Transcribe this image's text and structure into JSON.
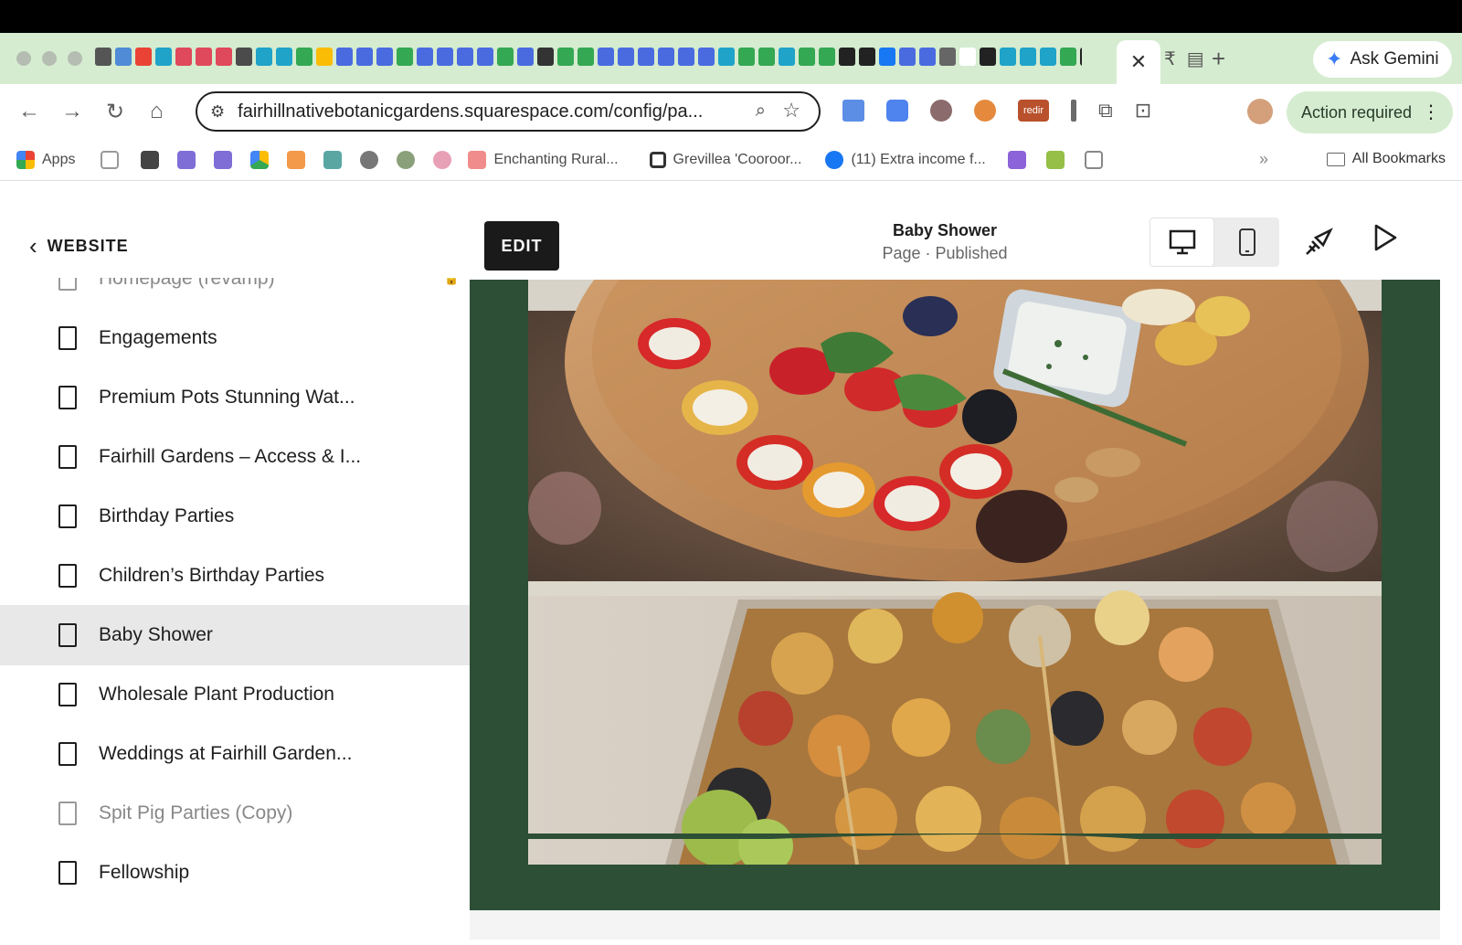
{
  "browser": {
    "ask_gemini_label": "Ask Gemini",
    "url": "fairhillnativebotanicgardens.squarespace.com/config/pa...",
    "action_required_label": "Action required",
    "bookmarks": {
      "apps_label": "Apps",
      "items": [
        "Enchanting Rural...",
        "Grevillea 'Cooroor...",
        "(11) Extra income f..."
      ],
      "all_bookmarks_label": "All Bookmarks"
    },
    "extension_badge": "redir"
  },
  "sidebar": {
    "back_label": "WEBSITE",
    "pages": [
      {
        "label": "Homepage (revamp)",
        "state": "partial"
      },
      {
        "label": "Engagements",
        "state": "normal"
      },
      {
        "label": "Premium Pots Stunning Wat...",
        "state": "normal"
      },
      {
        "label": "Fairhill Gardens – Access & I...",
        "state": "normal"
      },
      {
        "label": "Birthday Parties",
        "state": "normal"
      },
      {
        "label": "Children’s Birthday Parties",
        "state": "normal"
      },
      {
        "label": "Baby Shower",
        "state": "selected"
      },
      {
        "label": "Wholesale Plant Production",
        "state": "normal"
      },
      {
        "label": "Weddings at Fairhill Garden...",
        "state": "normal"
      },
      {
        "label": "Spit Pig Parties (Copy)",
        "state": "disabled"
      },
      {
        "label": "Fellowship",
        "state": "normal"
      }
    ]
  },
  "editor": {
    "edit_label": "EDIT",
    "page_title": "Baby Shower",
    "page_status": "Page · Published"
  },
  "colors": {
    "tabstrip_bg": "#d5ecd0",
    "canvas_green": "#2d4f35",
    "selected_row": "#e8e8e8"
  }
}
